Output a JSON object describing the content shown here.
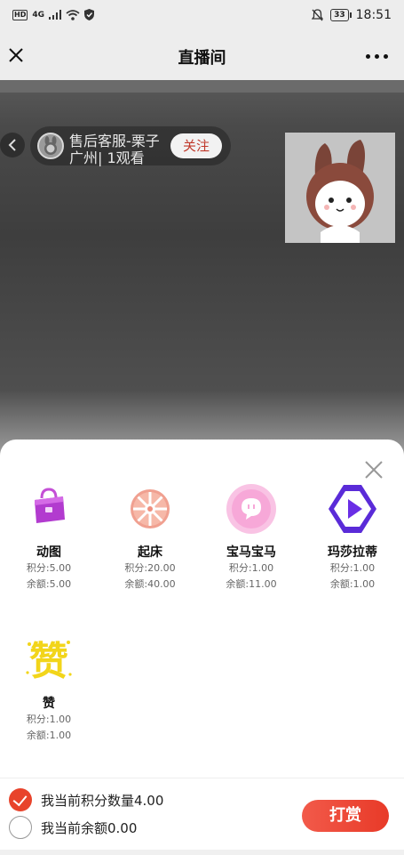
{
  "status_bar": {
    "network": "HD",
    "signal": "4G",
    "battery": "33",
    "time": "18:51"
  },
  "nav": {
    "title": "直播间",
    "close_icon": "close-icon",
    "more_icon": "more-icon"
  },
  "live": {
    "host_name": "售后客服-栗子",
    "host_meta": "广州| 1观看",
    "follow_label": "关注"
  },
  "gifts": [
    {
      "name": "动图",
      "points": "积分:5.00",
      "balance": "余额:5.00",
      "icon": "purple-bag-icon"
    },
    {
      "name": "起床",
      "points": "积分:20.00",
      "balance": "余额:40.00",
      "icon": "pinwheel-icon"
    },
    {
      "name": "宝马宝马",
      "points": "积分:1.00",
      "balance": "余额:11.00",
      "icon": "chat-bubble-icon"
    },
    {
      "name": "玛莎拉蒂",
      "points": "积分:1.00",
      "balance": "余额:1.00",
      "icon": "play-icon"
    },
    {
      "name": "赞",
      "points": "积分:1.00",
      "balance": "余额:1.00",
      "icon": "zan-icon"
    }
  ],
  "payment": {
    "option_points": "我当前积分数量4.00",
    "option_balance": "我当前余额0.00",
    "selected": "points",
    "tip_label": "打赏"
  },
  "colors": {
    "accent": "#e8432b",
    "follow_text": "#c0392b",
    "pinwheel": "#ef8f7e",
    "chat_bubble": "#f7a8d8",
    "play": "#6a2ee6"
  }
}
